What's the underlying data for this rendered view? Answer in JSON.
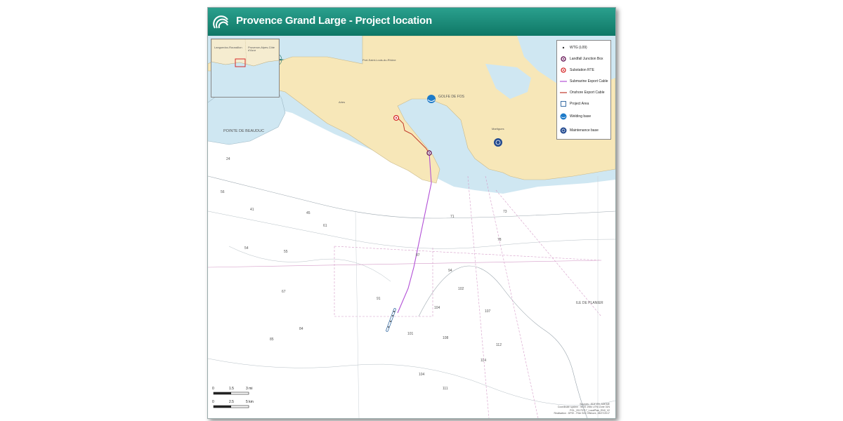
{
  "header": {
    "title": "Provence Grand Large - Project location"
  },
  "inset": {
    "labels": [
      "Languedoc-Roussillon",
      "Provence-Alpes-Côte d'Azur"
    ]
  },
  "legend": {
    "items": [
      {
        "label": "WTG (L09)",
        "icon": "dot-icon",
        "color": "#333333"
      },
      {
        "label": "Landfall Junction Box",
        "icon": "junction-box-icon",
        "color": "#6a1b5a"
      },
      {
        "label": "Substation RTE",
        "icon": "substation-icon",
        "color": "#d62828"
      },
      {
        "label": "Submarine Export Cable",
        "icon": "line-icon",
        "color": "#b24fd6"
      },
      {
        "label": "Onshore Export Cable",
        "icon": "line-icon",
        "color": "#c0392b"
      },
      {
        "label": "Project Area",
        "icon": "square-outline-icon",
        "color": "#3a6ea5"
      },
      {
        "label": "Welding base",
        "icon": "welding-base-icon",
        "color": "#1e7bc9"
      },
      {
        "label": "Maintenance base",
        "icon": "maintenance-base-icon",
        "color": "#234a8f"
      }
    ]
  },
  "map_labels": {
    "pointe": "POINTE DE BEAUDUC",
    "golfe": "GOLFE DE FOS",
    "port": "Port-Saint-Louis-du-Rhône",
    "arles": "Arles",
    "martigues": "Martigues",
    "planier": "ILE DE PLANIER",
    "depths": [
      "24",
      "41",
      "45",
      "55",
      "54",
      "56",
      "61",
      "67",
      "71",
      "73",
      "78",
      "84",
      "85",
      "87",
      "91",
      "94",
      "101",
      "102",
      "104",
      "104",
      "107",
      "108",
      "111",
      "112",
      "114"
    ]
  },
  "scale": {
    "mi_ticks": [
      "0",
      "1.5",
      "3 mi"
    ],
    "km_ticks": [
      "0",
      "2.5",
      "5 km"
    ]
  },
  "credits": [
    "Sources : EDF EN, ADEME",
    "Coordinate system : WGS 1984 UTM Zone 31N",
    "PGL_20170717_LocalPlan_EN0_V2",
    "Realisation : DPIH - Pôle SIG Offshore, 28/07/2017"
  ],
  "colors": {
    "land": "#f7e7b8",
    "shallow": "#cfe7f2",
    "sea": "#ffffff",
    "header": "#159080"
  }
}
